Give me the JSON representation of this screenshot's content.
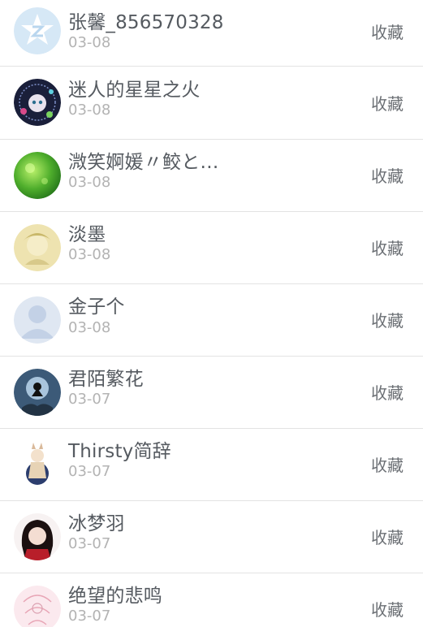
{
  "items": [
    {
      "name": "张馨_856570328",
      "date": "03-08",
      "action": "收藏",
      "avatar": "qzone-default-avatar"
    },
    {
      "name": "迷人的星星之火",
      "date": "03-08",
      "action": "收藏",
      "avatar": "anime-girl-avatar"
    },
    {
      "name": "溦笑婀媛〃鲛と…",
      "date": "03-08",
      "action": "收藏",
      "avatar": "green-bokeh-avatar"
    },
    {
      "name": "淡墨",
      "date": "03-08",
      "action": "收藏",
      "avatar": "pale-yellow-avatar"
    },
    {
      "name": "金子个",
      "date": "03-08",
      "action": "收藏",
      "avatar": "default-person-avatar"
    },
    {
      "name": "君陌繁花",
      "date": "03-07",
      "action": "收藏",
      "avatar": "moon-silhouette-avatar"
    },
    {
      "name": "Thirsty简辞",
      "date": "03-07",
      "action": "收藏",
      "avatar": "anime-character-avatar"
    },
    {
      "name": "冰梦羽",
      "date": "03-07",
      "action": "收藏",
      "avatar": "dark-hair-girl-avatar"
    },
    {
      "name": "绝望的悲鸣",
      "date": "03-07",
      "action": "收藏",
      "avatar": "pink-sketch-avatar"
    }
  ]
}
